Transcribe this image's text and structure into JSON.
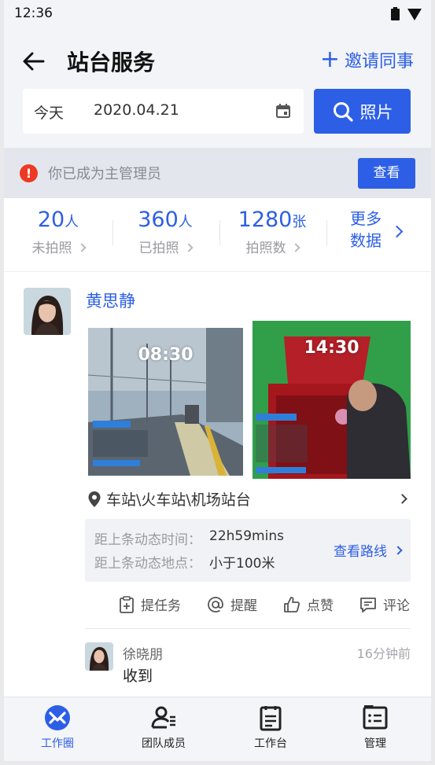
{
  "status_bar": {
    "time": "12:36"
  },
  "header": {
    "title": "站台服务",
    "invite_label": "邀请同事",
    "date_prefix": "今天",
    "date_value": "2020.04.21",
    "photo_button": "照片"
  },
  "notice": {
    "text": "你已成为主管理员",
    "button": "查看"
  },
  "stats": [
    {
      "value": "20",
      "unit": "人",
      "label": "未拍照"
    },
    {
      "value": "360",
      "unit": "人",
      "label": "已拍照"
    },
    {
      "value": "1280",
      "unit": "张",
      "label": "拍照数"
    }
  ],
  "more_data": {
    "line1": "更多",
    "line2": "数据"
  },
  "post": {
    "author": "黄思静",
    "photos": [
      {
        "time": "08:30"
      },
      {
        "time": "14:30"
      }
    ],
    "location": "车站\\火车站\\机场站台",
    "info": {
      "time_label": "距上条动态时间：",
      "time_value": "22h59mins",
      "place_label": "距上条动态地点：",
      "place_value": "小于100米",
      "route_link": "查看路线"
    },
    "actions": [
      "提任务",
      "提醒",
      "点赞",
      "评论"
    ],
    "comment": {
      "author": "徐晓朋",
      "time": "16分钟前",
      "text": "收到"
    }
  },
  "tabbar": [
    {
      "label": "工作圈",
      "active": true
    },
    {
      "label": "团队成员",
      "active": false
    },
    {
      "label": "工作台",
      "active": false
    },
    {
      "label": "管理",
      "active": false
    }
  ],
  "colors": {
    "accent": "#2d5fe6",
    "warning": "#ec3a24"
  }
}
